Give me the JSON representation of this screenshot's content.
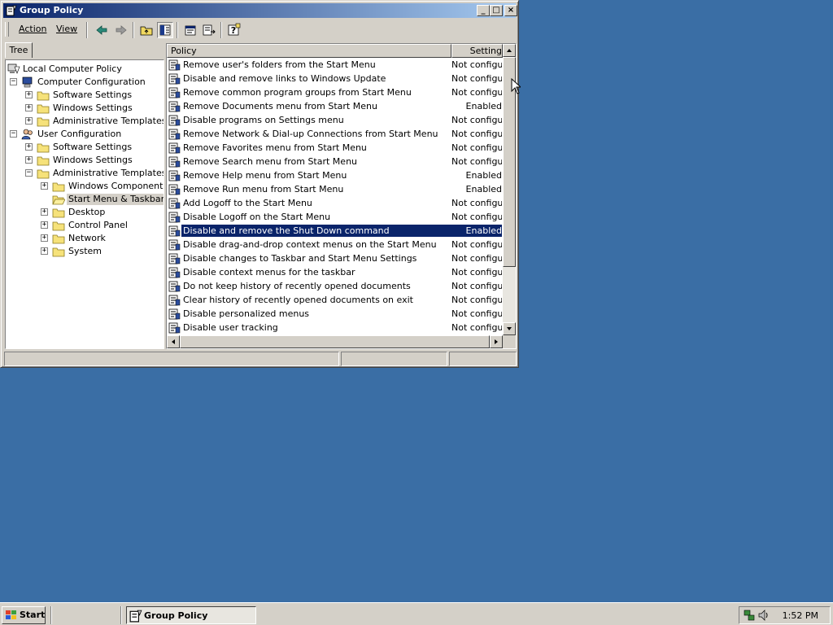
{
  "window": {
    "title": "Group Policy",
    "minimize_glyph": "_",
    "maximize_glyph": "□",
    "close_glyph": "×"
  },
  "menu": {
    "action": "Action",
    "view": "View"
  },
  "toolbar": {
    "icons": [
      "back-arrow-icon",
      "forward-arrow-icon",
      "up-one-level-icon",
      "show-hide-tree-icon",
      "properties-icon",
      "export-list-icon",
      "help-icon"
    ]
  },
  "tree": {
    "tab_label": "Tree",
    "root": "Local Computer Policy",
    "computer_configuration": "Computer Configuration",
    "cc_software_settings": "Software Settings",
    "cc_windows_settings": "Windows Settings",
    "cc_administrative_templates": "Administrative Templates",
    "user_configuration": "User Configuration",
    "uc_software_settings": "Software Settings",
    "uc_windows_settings": "Windows Settings",
    "uc_administrative_templates": "Administrative Templates",
    "windows_components": "Windows Components",
    "start_menu_taskbar": "Start Menu & Taskbar",
    "desktop": "Desktop",
    "control_panel": "Control Panel",
    "network": "Network",
    "system": "System",
    "expand_glyph": "+",
    "collapse_glyph": "−"
  },
  "list": {
    "col_policy": "Policy",
    "col_setting": "Setting",
    "rows": [
      {
        "policy": "Remove user's folders from the Start Menu",
        "setting": "Not configured"
      },
      {
        "policy": "Disable and remove links to Windows Update",
        "setting": "Not configured"
      },
      {
        "policy": "Remove common program groups from Start Menu",
        "setting": "Not configured"
      },
      {
        "policy": "Remove Documents menu from Start Menu",
        "setting": "Enabled"
      },
      {
        "policy": "Disable programs on Settings menu",
        "setting": "Not configured"
      },
      {
        "policy": "Remove Network & Dial-up Connections from Start Menu",
        "setting": "Not configured"
      },
      {
        "policy": "Remove Favorites menu from Start Menu",
        "setting": "Not configured"
      },
      {
        "policy": "Remove Search menu from Start Menu",
        "setting": "Not configured"
      },
      {
        "policy": "Remove Help menu from Start Menu",
        "setting": "Enabled"
      },
      {
        "policy": "Remove Run menu from Start Menu",
        "setting": "Enabled"
      },
      {
        "policy": "Add Logoff to the Start Menu",
        "setting": "Not configured"
      },
      {
        "policy": "Disable Logoff on the Start Menu",
        "setting": "Not configured"
      },
      {
        "policy": "Disable and remove the Shut Down command",
        "setting": "Enabled"
      },
      {
        "policy": "Disable drag-and-drop context menus on the Start Menu",
        "setting": "Not configured"
      },
      {
        "policy": "Disable changes to Taskbar and Start Menu Settings",
        "setting": "Not configured"
      },
      {
        "policy": "Disable context menus for the taskbar",
        "setting": "Not configured"
      },
      {
        "policy": "Do not keep history of recently opened documents",
        "setting": "Not configured"
      },
      {
        "policy": "Clear history of recently opened documents on exit",
        "setting": "Not configured"
      },
      {
        "policy": "Disable personalized menus",
        "setting": "Not configured"
      },
      {
        "policy": "Disable user tracking",
        "setting": "Not configured"
      }
    ],
    "selected_index": 12
  },
  "colors": {
    "desktop": "#3a6ea5",
    "title_active": "#0a246a",
    "selection": "#0a246a",
    "face": "#d4d0c8"
  },
  "taskbar": {
    "start_label": "Start",
    "task_label": "Group Policy",
    "clock": "1:52 PM",
    "tray_icons": [
      "network-icon",
      "volume-icon"
    ]
  }
}
